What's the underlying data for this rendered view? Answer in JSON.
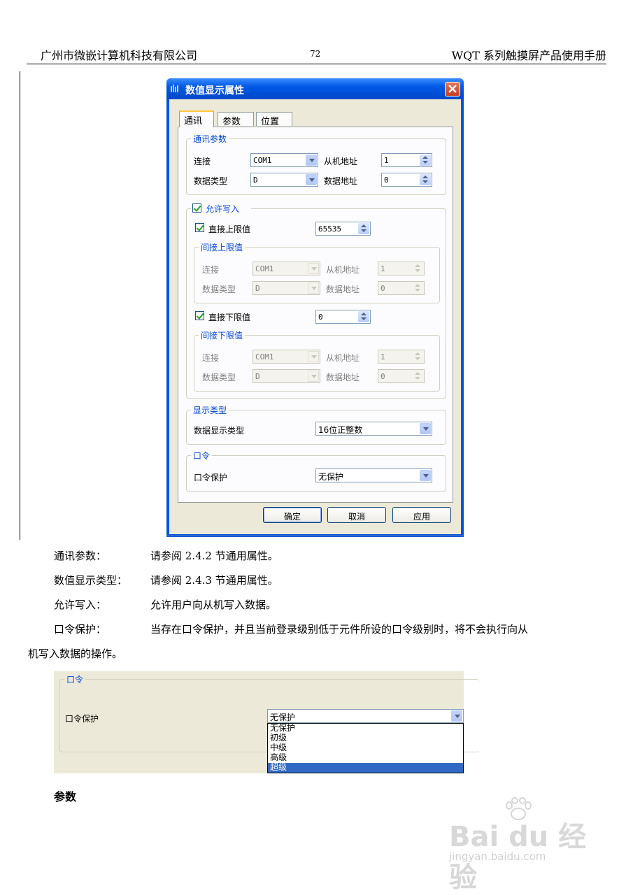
{
  "header": {
    "company": "广州市微嵌计算机科技有限公司",
    "page_number": "72",
    "manual_title": "WQT 系列触摸屏产品使用手册"
  },
  "dialog": {
    "title": "数值显示属性",
    "tabs": [
      "通讯",
      "参数",
      "位置"
    ],
    "comm_group": {
      "legend": "通讯参数",
      "connection_label": "连接",
      "connection_value": "COM1",
      "slave_label": "从机地址",
      "slave_value": "1",
      "datatype_label": "数据类型",
      "datatype_value": "D",
      "dataaddr_label": "数据地址",
      "dataaddr_value": "0"
    },
    "write_group": {
      "legend": "允许写入",
      "direct_upper_label": "直接上限值",
      "direct_upper_value": "65535",
      "indirect_upper": {
        "legend": "间接上限值",
        "connection_label": "连接",
        "connection_value": "COM1",
        "slave_label": "从机地址",
        "slave_value": "1",
        "datatype_label": "数据类型",
        "datatype_value": "D",
        "dataaddr_label": "数据地址",
        "dataaddr_value": "0"
      },
      "direct_lower_label": "直接下限值",
      "direct_lower_value": "0",
      "indirect_lower": {
        "legend": "间接下限值",
        "connection_label": "连接",
        "connection_value": "COM1",
        "slave_label": "从机地址",
        "slave_value": "1",
        "datatype_label": "数据类型",
        "datatype_value": "D",
        "dataaddr_label": "数据地址",
        "dataaddr_value": "0"
      }
    },
    "display_group": {
      "legend": "显示类型",
      "label": "数据显示类型",
      "value": "16位正整数"
    },
    "password_group": {
      "legend": "口令",
      "label": "口令保护",
      "value": "无保护"
    },
    "buttons": {
      "ok": "确定",
      "cancel": "取消",
      "apply": "应用"
    }
  },
  "body": {
    "p1_term": "通讯参数：",
    "p1_text": "请参阅 2.4.2 节通用属性。",
    "p2_term": "数值显示类型：",
    "p2_text": "请参阅 2.4.3 节通用属性。",
    "p3_term": "允许写入：",
    "p3_text": "允许用户向从机写入数据。",
    "p4_term": "口令保护：",
    "p4_text_a": "当存在口令保护，并且当前登录级别低于元件所设的口令级别时，将不会执行向从",
    "p4_text_b": "机写入数据的操作。",
    "section_title": "参数"
  },
  "password_screenshot": {
    "legend": "口令",
    "label": "口令保护",
    "value": "无保护",
    "options": [
      "无保护",
      "初级",
      "中级",
      "高级",
      "超级"
    ],
    "selected_index": 4
  },
  "watermark": {
    "brand": "Bai du 经验",
    "url": "jingyan.baidu.com"
  }
}
